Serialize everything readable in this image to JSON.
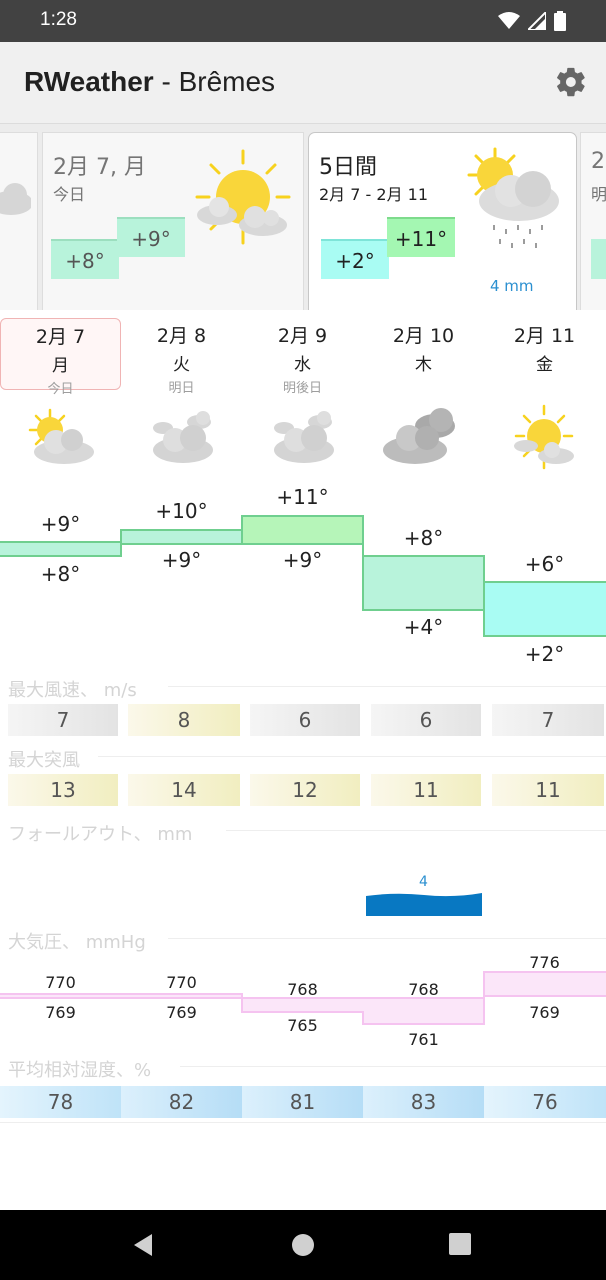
{
  "status_bar": {
    "time": "1:28"
  },
  "app_bar": {
    "app_name": "RWeather",
    "separator": " - ",
    "location": "Brêmes"
  },
  "summary_cards": [
    {
      "date": "2月 7, 月",
      "label": "今日",
      "temp_low": "+8°",
      "temp_high": "+9°"
    },
    {
      "date": "5日間",
      "label": "2月 7 - 2月 11",
      "temp_low": "+2°",
      "temp_high": "+11°",
      "precip": "4 mm"
    },
    {
      "date": "2",
      "label": "明"
    }
  ],
  "days": [
    {
      "date": "2月 7",
      "weekday": "月",
      "label": "今日",
      "icon": "sun-cloud-icon"
    },
    {
      "date": "2月 8",
      "weekday": "火",
      "label": "明日",
      "icon": "cloud-icon"
    },
    {
      "date": "2月 9",
      "weekday": "水",
      "label": "明後日",
      "icon": "cloud-icon"
    },
    {
      "date": "2月 10",
      "weekday": "木",
      "label": "",
      "icon": "dark-cloud-icon"
    },
    {
      "date": "2月 11",
      "weekday": "金",
      "label": "",
      "icon": "sun-cloud-icon"
    }
  ],
  "temperature": {
    "high": [
      "+9°",
      "+10°",
      "+11°",
      "+8°",
      "+6°"
    ],
    "low": [
      "+8°",
      "+9°",
      "+9°",
      "+4°",
      "+2°"
    ]
  },
  "wind": {
    "title": "最大風速、 m/s",
    "values": [
      "7",
      "8",
      "6",
      "6",
      "7"
    ]
  },
  "gust": {
    "title": "最大突風",
    "values": [
      "13",
      "14",
      "12",
      "11",
      "11"
    ]
  },
  "precip": {
    "title": "フォールアウト、 mm",
    "values": [
      "",
      "",
      "",
      "4",
      ""
    ]
  },
  "pressure": {
    "title": "大気圧、 mmHg",
    "high": [
      "770",
      "770",
      "768",
      "768",
      "776"
    ],
    "low": [
      "769",
      "769",
      "765",
      "761",
      "769"
    ]
  },
  "humidity": {
    "title": "平均相対湿度、%",
    "values": [
      "78",
      "82",
      "81",
      "83",
      "76"
    ]
  },
  "colors": {
    "accent": "#2a8fd0",
    "temp_green": "#b6f5d0",
    "temp_cyan": "#a9fcf3",
    "pressure": "#f5c3f0"
  }
}
